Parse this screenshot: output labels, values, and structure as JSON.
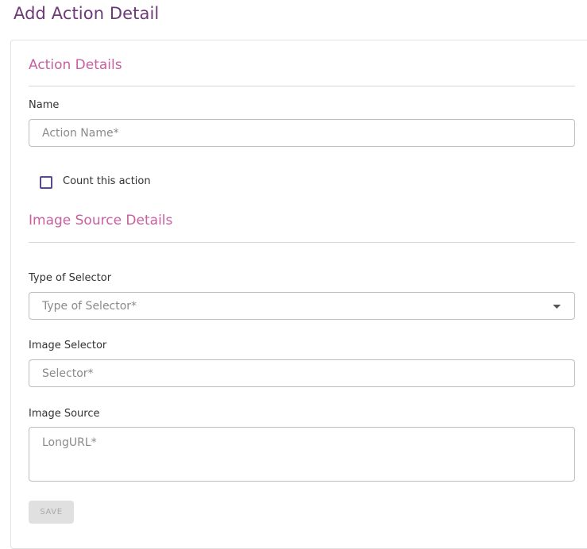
{
  "page": {
    "title": "Add Action Detail"
  },
  "action_details": {
    "section_title": "Action Details",
    "name_label": "Name",
    "name_placeholder": "Action Name*",
    "count_checkbox_label": "Count this action",
    "count_checked": false
  },
  "image_source_details": {
    "section_title": "Image Source Details",
    "type_label": "Type of Selector",
    "type_placeholder": "Type of Selector*",
    "selector_label": "Image Selector",
    "selector_placeholder": "Selector*",
    "source_label": "Image Source",
    "source_placeholder": "LongURL*"
  },
  "actions": {
    "save_label": "SAVE",
    "save_disabled": true
  },
  "colors": {
    "title": "#6d3a77",
    "section_title": "#c75fa0",
    "checkbox_border": "#5b4a8b"
  },
  "icons": {
    "dropdown": "caret-down-icon"
  }
}
